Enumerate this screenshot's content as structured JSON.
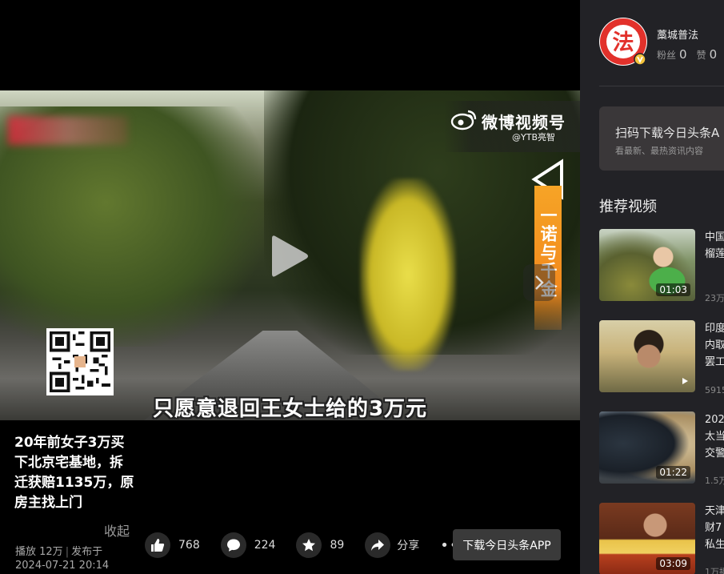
{
  "video": {
    "watermark_platform": "微博视频号",
    "watermark_handle": "@YTB亮智",
    "vertical_caption": "一诺与千金",
    "subtitle": "只愿意退回王女士给的3万元",
    "title": "20年前女子3万买下北京宅基地，拆迁获赔1135万，原房主找上门",
    "collapse_label": "收起",
    "views_label": "播放 12万",
    "publish_prefix": "发布于",
    "publish_time": "2024-07-21 20:14"
  },
  "actions": {
    "like_count": "768",
    "comment_count": "224",
    "favorite_count": "89",
    "share_label": "分享",
    "download_label": "下载今日头条APP"
  },
  "author": {
    "avatar_text": "法",
    "name": "藁城普法",
    "fans_label": "粉丝",
    "fans_count": "0",
    "likes_label": "赞",
    "likes_count": "0"
  },
  "promo": {
    "title": "扫码下载今日头条A",
    "subtitle": "看最新、最热资讯内容"
  },
  "recommend": {
    "heading": "推荐视频",
    "items": [
      {
        "title": "中国\n榴莲",
        "duration": "01:03",
        "count": "23万"
      },
      {
        "title": "印度\n内取\n罢工",
        "duration": "",
        "count": "5915"
      },
      {
        "title": "202\n太当\n交警",
        "duration": "01:22",
        "count": "1.5万"
      },
      {
        "title": "天津\n财7\n私生",
        "duration": "03:09",
        "count": "1万播"
      }
    ]
  },
  "colors": {
    "brand_red": "#e2312b",
    "orange": "#f28a1e",
    "sidebar_bg": "#222226",
    "button_bg": "#3a3a3a"
  },
  "icons": [
    "play-icon",
    "like-icon",
    "comment-icon",
    "star-icon",
    "share-icon",
    "more-icon",
    "weibo-icon",
    "chevron-right-icon",
    "verified-icon"
  ]
}
